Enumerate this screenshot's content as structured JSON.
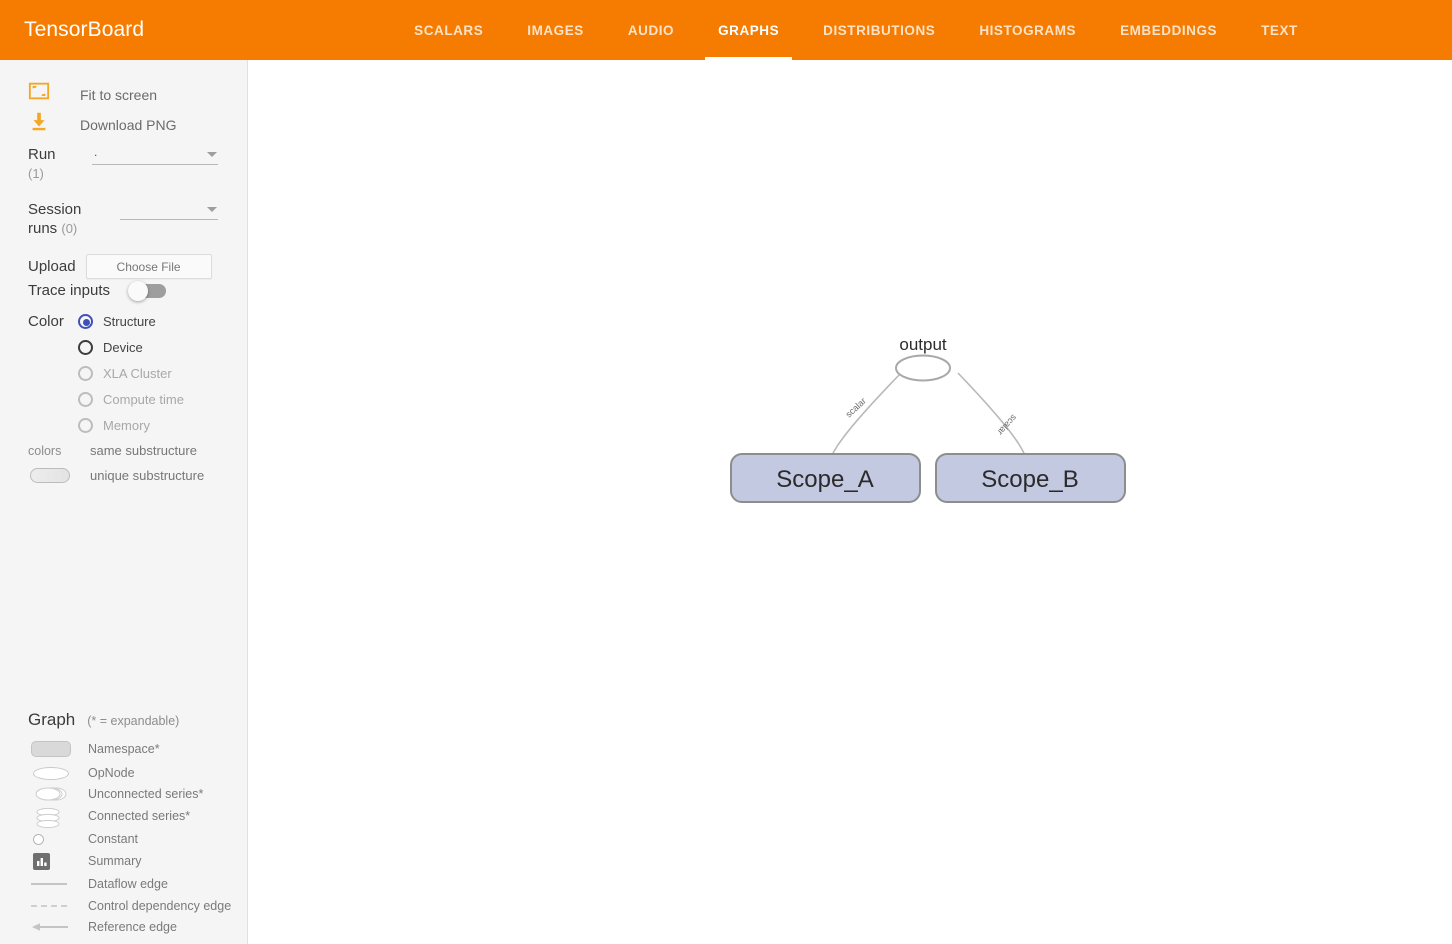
{
  "app": {
    "brand": "TensorBoard",
    "accent_color": "#f57c00"
  },
  "tabs": [
    {
      "label": "SCALARS",
      "active": false
    },
    {
      "label": "IMAGES",
      "active": false
    },
    {
      "label": "AUDIO",
      "active": false
    },
    {
      "label": "GRAPHS",
      "active": true
    },
    {
      "label": "DISTRIBUTIONS",
      "active": false
    },
    {
      "label": "HISTOGRAMS",
      "active": false
    },
    {
      "label": "EMBEDDINGS",
      "active": false
    },
    {
      "label": "TEXT",
      "active": false
    }
  ],
  "sidebar": {
    "actions": [
      {
        "label": "Fit to screen",
        "icon": "fit-to-screen-icon"
      },
      {
        "label": "Download PNG",
        "icon": "download-icon"
      }
    ],
    "run": {
      "label": "Run",
      "count": "(1)",
      "value": "."
    },
    "session_runs": {
      "label": "Session",
      "label2": "runs",
      "count": "(0)",
      "value": ""
    },
    "upload": {
      "label": "Upload",
      "button_label": "Choose File"
    },
    "trace_inputs": {
      "label": "Trace inputs",
      "enabled": false
    },
    "color": {
      "label": "Color",
      "options": [
        {
          "label": "Structure",
          "selected": true,
          "disabled": false
        },
        {
          "label": "Device",
          "selected": false,
          "disabled": false
        },
        {
          "label": "XLA Cluster",
          "selected": false,
          "disabled": true
        },
        {
          "label": "Compute time",
          "selected": false,
          "disabled": true
        },
        {
          "label": "Memory",
          "selected": false,
          "disabled": true
        }
      ],
      "legend": {
        "key": "colors",
        "same": "same substructure",
        "unique": "unique substructure"
      }
    },
    "graph_legend": {
      "title": "Graph",
      "subtitle": "(* = expandable)",
      "items": [
        {
          "label": "Namespace*",
          "icon": "namespace-icon"
        },
        {
          "label": "OpNode",
          "icon": "opnode-icon"
        },
        {
          "label": "Unconnected series*",
          "icon": "unconnected-series-icon"
        },
        {
          "label": "Connected series*",
          "icon": "connected-series-icon"
        },
        {
          "label": "Constant",
          "icon": "constant-icon"
        },
        {
          "label": "Summary",
          "icon": "summary-icon"
        },
        {
          "label": "Dataflow edge",
          "icon": "dataflow-edge-icon"
        },
        {
          "label": "Control dependency edge",
          "icon": "control-dependency-edge-icon"
        },
        {
          "label": "Reference edge",
          "icon": "reference-edge-icon"
        }
      ]
    }
  },
  "graph": {
    "node_fill": "#c2c9e0",
    "node_stroke": "#8d8d8d",
    "nodes": [
      {
        "id": "output",
        "label": "output",
        "type": "opnode"
      },
      {
        "id": "scope_a",
        "label": "Scope_A",
        "type": "namespace"
      },
      {
        "id": "scope_b",
        "label": "Scope_B",
        "type": "namespace"
      }
    ],
    "edges": [
      {
        "from": "scope_a",
        "to": "output",
        "label": "scalar"
      },
      {
        "from": "scope_b",
        "to": "output",
        "label": "scalar"
      }
    ]
  }
}
